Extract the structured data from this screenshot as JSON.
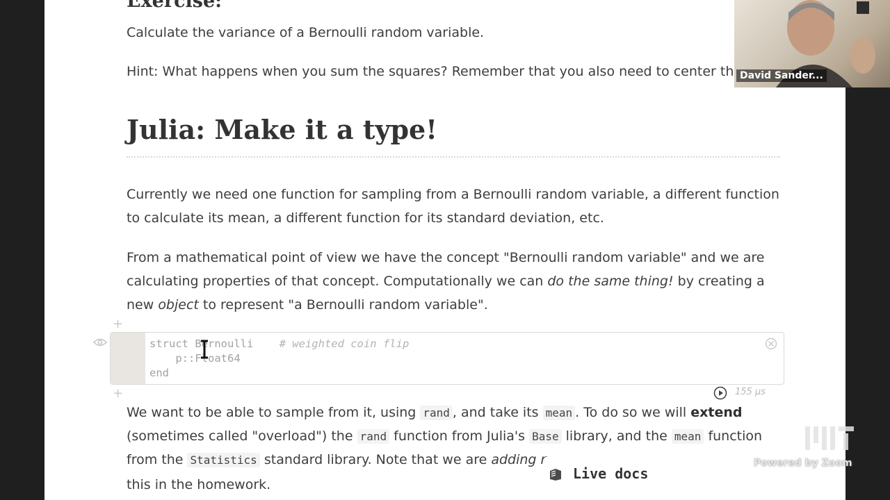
{
  "exercise": {
    "title": "Exercise:",
    "task": "Calculate the variance of a Bernoulli random variable.",
    "hint": "Hint: What happens when you sum the squares? Remember that you also need to center the dat"
  },
  "section": {
    "heading": "Julia: Make it a type!",
    "para1": "Currently we need one function for sampling from a Bernoulli random variable, a different function to calculate its mean, a different function for its standard deviation, etc.",
    "para2_start": "From a mathematical point of view we have the concept \"Bernoulli random variable\" and we are calculating properties of that concept. Computationally we can ",
    "para2_em1": "do the same thing!",
    "para2_mid": " by creating a new ",
    "para2_em2": "object",
    "para2_end": " to represent \"a Bernoulli random variable\"."
  },
  "cell": {
    "line1": "struct Bernoulli",
    "comment": "# weighted coin flip",
    "line2": "    p::Float64",
    "line3": "end",
    "runtime": "155 μs"
  },
  "after": {
    "t1": "We want to be able to sample from it, using ",
    "c1": "rand",
    "t2": ", and take its ",
    "c2": "mean",
    "t3": ". To do so we will ",
    "b1": "extend",
    "t4": "(sometimes called \"overload\") the ",
    "c3": "rand",
    "t5": " function from Julia's ",
    "c4": "Base",
    "t6": " library, and the ",
    "c5": "mean",
    "t7": " function",
    "t8": "from the ",
    "c6": "Statistics",
    "t9": " standard library. Note that we are ",
    "em1": "adding n",
    "t10": "this in the homework."
  },
  "live_docs": {
    "label": "Live docs",
    "icon": "book-icon"
  },
  "webcam": {
    "name": "David Sander..."
  },
  "watermark": {
    "powered_by": "Powered by Zoom",
    "logo": "MIT"
  }
}
